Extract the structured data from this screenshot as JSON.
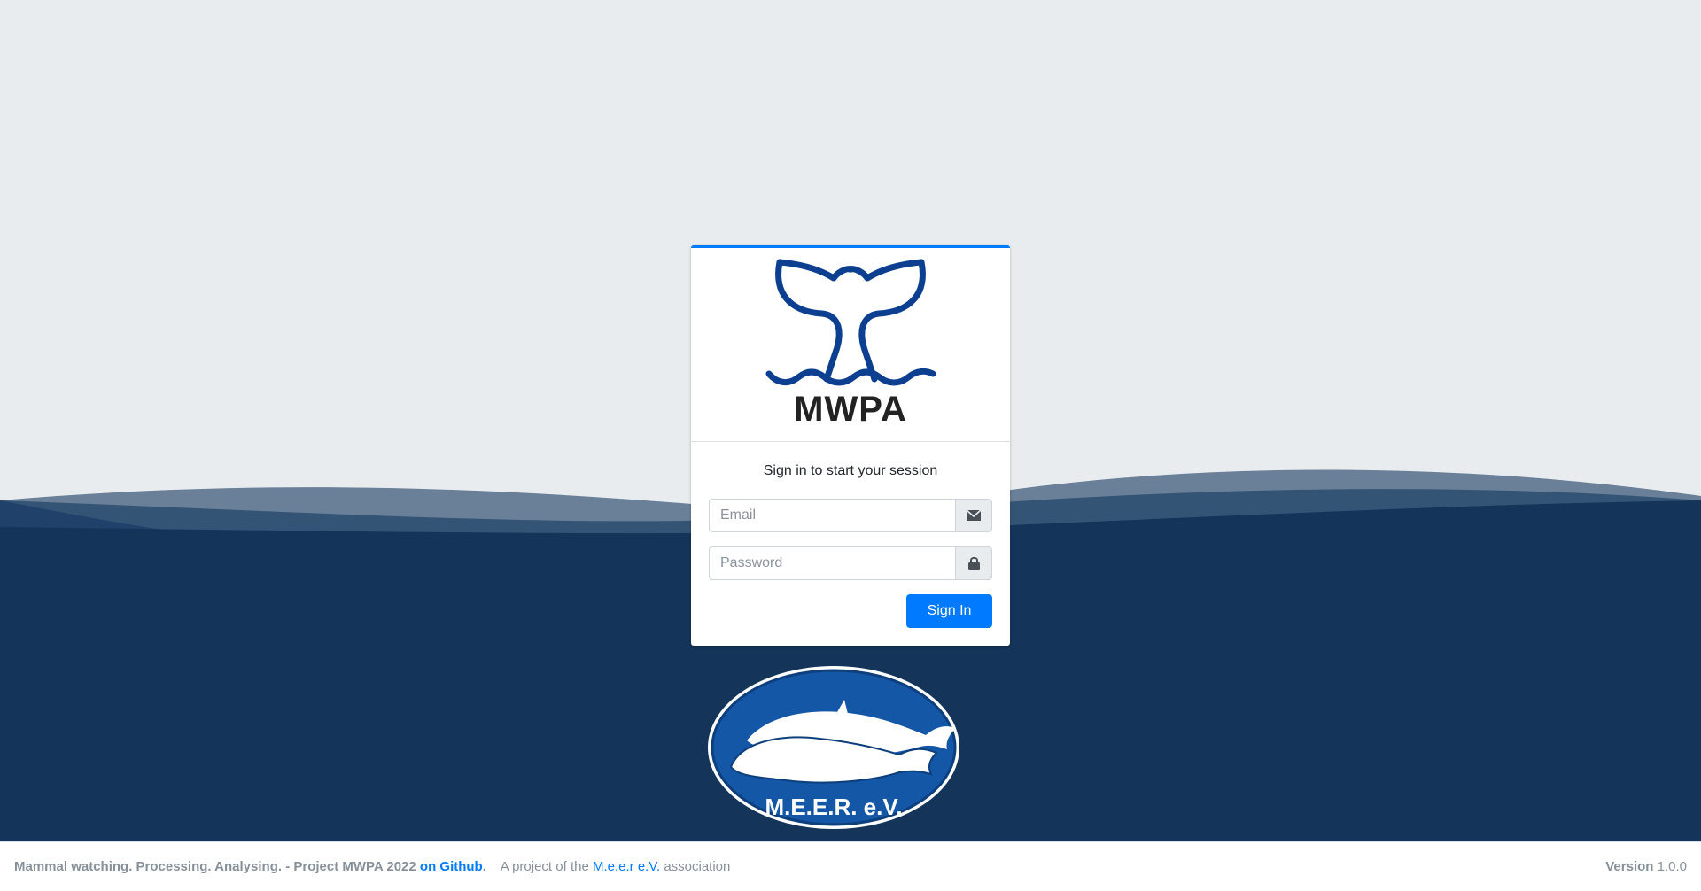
{
  "colors": {
    "background": "#e9ecef",
    "wave_dark": "#143559",
    "accent": "#007bff",
    "logo_blue": "#0d3f91"
  },
  "brand": {
    "logo_icon": "whale-tail-icon",
    "name": "MWPA"
  },
  "login": {
    "message": "Sign in to start your session",
    "email_placeholder": "Email",
    "email_icon": "envelope-icon",
    "password_placeholder": "Password",
    "password_icon": "lock-icon",
    "submit_label": "Sign In"
  },
  "association_logo": {
    "icon": "meer-whale-emblem",
    "text": "M.E.E.R. e.V."
  },
  "footer": {
    "tagline": "Mammal watching. Processing. Analysing. - Project MWPA 2022",
    "github_link": "on Github",
    "github_period": ".",
    "project_prefix": "A project of the",
    "association_link": "M.e.e.r e.V.",
    "project_suffix": "association",
    "version_label": "Version",
    "version_value": "1.0.0"
  }
}
